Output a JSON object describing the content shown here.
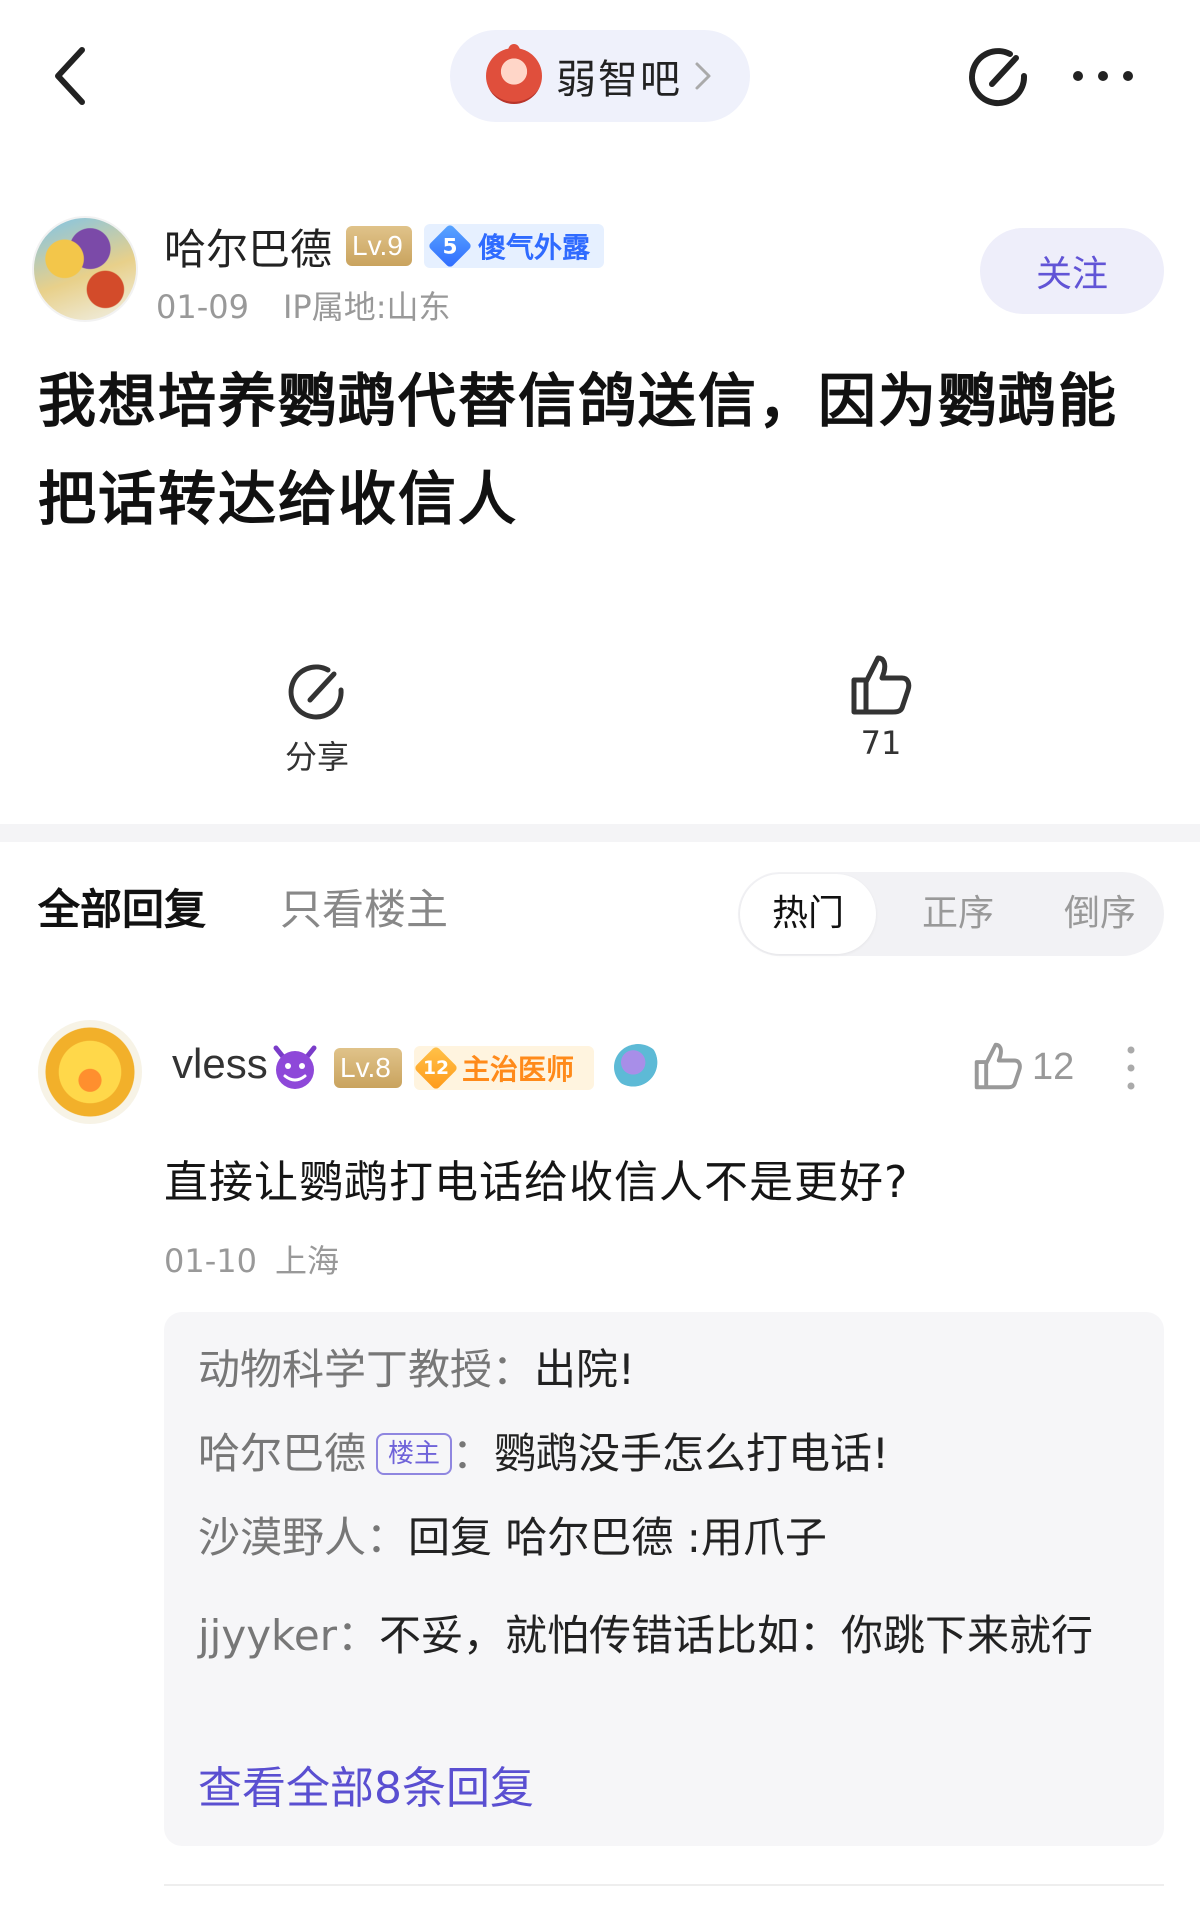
{
  "header": {
    "forum_name": "弱智吧"
  },
  "post": {
    "author": "哈尔巴德",
    "level": "Lv.9",
    "honor_level": "5",
    "honor_title": "傻气外露",
    "date": "01-09",
    "ip": "IP属地:山东",
    "follow_label": "关注",
    "title": "我想培养鹦鹉代替信鸽送信，因为鹦鹉能把话转达给收信人",
    "share_label": "分享",
    "like_count": "71"
  },
  "replies_tabs": {
    "all": "全部回复",
    "op_only": "只看楼主",
    "sort": [
      "热门",
      "正序",
      "倒序"
    ]
  },
  "comment": {
    "user": "vless",
    "level": "Lv.8",
    "title_level": "12",
    "title_text": "主治医师",
    "like_count": "12",
    "text": "直接让鹦鹉打电话给收信人不是更好?",
    "date": "01-10",
    "location": "上海",
    "sub_replies": [
      {
        "who": "动物科学丁教授",
        "sep": "：",
        "text": "出院!"
      },
      {
        "who": "哈尔巴德",
        "tag": "楼主",
        "sep": "：",
        "text": "鹦鹉没手怎么打电话!"
      },
      {
        "who": "沙漠野人",
        "sep": "：",
        "text": "回复 哈尔巴德 :用爪子"
      },
      {
        "who": "jjyyker",
        "sep": "：",
        "text": "不妥，就怕传错话比如：你跳下来就行"
      }
    ],
    "view_all": "查看全部8条回复"
  },
  "icons": {
    "back": "chevron-left-icon",
    "edit": "compose-icon",
    "more": "more-dots-icon",
    "share": "share-icon",
    "like": "thumbs-up-icon"
  },
  "colors": {
    "accent": "#6154d6",
    "level_badge": "#c9a35e",
    "honor_blue": "#2f6bff",
    "doctor_orange": "#ff8a1a"
  }
}
